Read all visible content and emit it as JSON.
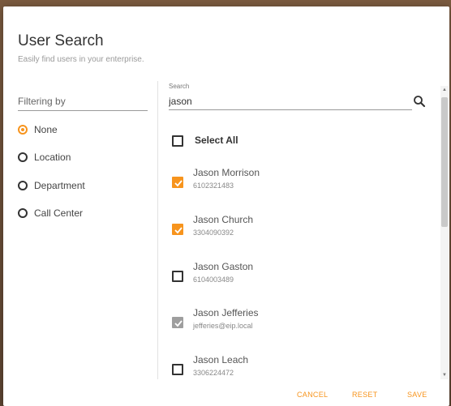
{
  "dialog": {
    "title": "User Search",
    "subtitle": "Easily find users in your enterprise."
  },
  "filter": {
    "label": "Filtering by",
    "options": [
      {
        "label": "None",
        "selected": true
      },
      {
        "label": "Location",
        "selected": false
      },
      {
        "label": "Department",
        "selected": false
      },
      {
        "label": "Call Center",
        "selected": false
      }
    ]
  },
  "search": {
    "caption": "Search",
    "value": "jason",
    "icon": "search-icon"
  },
  "list": {
    "select_all_label": "Select All",
    "select_all_checked": false,
    "users": [
      {
        "name": "Jason Morrison",
        "detail": "6102321483",
        "state": "checked"
      },
      {
        "name": "Jason Church",
        "detail": "3304090392",
        "state": "checked"
      },
      {
        "name": "Jason Gaston",
        "detail": "6104003489",
        "state": "unchecked"
      },
      {
        "name": "Jason Jefferies",
        "detail": "jefferies@eip.local",
        "state": "disabled-checked"
      },
      {
        "name": "Jason Leach",
        "detail": "3306224472",
        "state": "unchecked"
      }
    ]
  },
  "actions": {
    "cancel": "CANCEL",
    "reset": "RESET",
    "save": "SAVE"
  },
  "colors": {
    "accent": "#f7941d",
    "disabled": "#9e9e9e"
  }
}
